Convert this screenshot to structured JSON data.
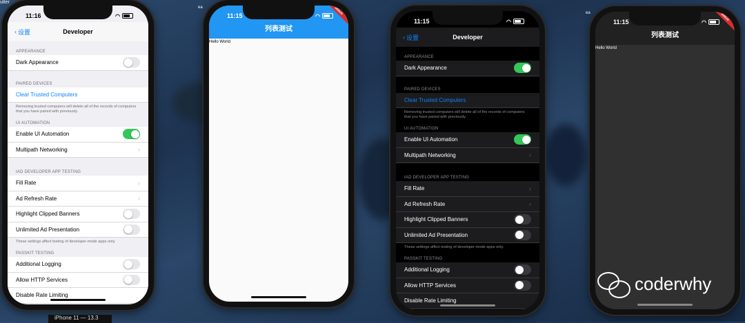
{
  "desktop": {
    "top_left_fragment": "utter",
    "simulator_label": "iPhone 11 — 13.3",
    "side_fragments": [
      "ea",
      "ea"
    ]
  },
  "phone1": {
    "time": "11:16",
    "back_label": "设置",
    "title": "Developer",
    "sections": {
      "appearance": "APPEARANCE",
      "paired": "PAIRED DEVICES",
      "ui_automation": "UI AUTOMATION",
      "iad": "IAD DEVELOPER APP TESTING",
      "passkit": "PASSKIT TESTING"
    },
    "rows": {
      "dark_appearance": "Dark Appearance",
      "clear_trusted": "Clear Trusted Computers",
      "enable_ui_automation": "Enable UI Automation",
      "multipath": "Multipath Networking",
      "fill_rate": "Fill Rate",
      "ad_refresh": "Ad Refresh Rate",
      "highlight_banners": "Highlight Clipped Banners",
      "unlimited_ad": "Unlimited Ad Presentation",
      "additional_logging": "Additional Logging",
      "allow_http": "Allow HTTP Services",
      "disable_rate": "Disable Rate Limiting"
    },
    "footers": {
      "paired": "Removing trusted computers will delete all of the records of computers that you have paired with previously.",
      "iad": "These settings affect testing of developer-mode apps only."
    },
    "toggles": {
      "dark_appearance": false,
      "enable_ui_automation": true,
      "highlight_banners": false,
      "unlimited_ad": false,
      "additional_logging": false,
      "allow_http": false
    }
  },
  "phone2": {
    "time": "11:15",
    "title": "列表测试",
    "body_text": "Hello World",
    "banner": "DEBUG",
    "appbar_color": "#2196f3"
  },
  "phone3": {
    "time": "11:15",
    "back_label": "设置",
    "title": "Developer",
    "sections": {
      "appearance": "APPEARANCE",
      "paired": "PAIRED DEVICES",
      "ui_automation": "UI AUTOMATION",
      "iad": "IAD DEVELOPER APP TESTING",
      "passkit": "PASSKIT TESTING"
    },
    "rows": {
      "dark_appearance": "Dark Appearance",
      "clear_trusted": "Clear Trusted Computers",
      "enable_ui_automation": "Enable UI Automation",
      "multipath": "Multipath Networking",
      "fill_rate": "Fill Rate",
      "ad_refresh": "Ad Refresh Rate",
      "highlight_banners": "Highlight Clipped Banners",
      "unlimited_ad": "Unlimited Ad Presentation",
      "additional_logging": "Additional Logging",
      "allow_http": "Allow HTTP Services",
      "disable_rate": "Disable Rate Limiting"
    },
    "footers": {
      "paired": "Removing trusted computers will delete all of the records of computers that you have paired with previously.",
      "iad": "These settings affect testing of developer-mode apps only."
    },
    "toggles": {
      "dark_appearance": true,
      "enable_ui_automation": true,
      "highlight_banners": false,
      "unlimited_ad": false,
      "additional_logging": false,
      "allow_http": false
    }
  },
  "phone4": {
    "time": "11:15",
    "title": "列表测试",
    "body_text": "Hello World",
    "banner": "DEBUG",
    "appbar_color": "#212121"
  },
  "watermark": {
    "text": "coderwhy",
    "icon": "wechat-icon"
  }
}
